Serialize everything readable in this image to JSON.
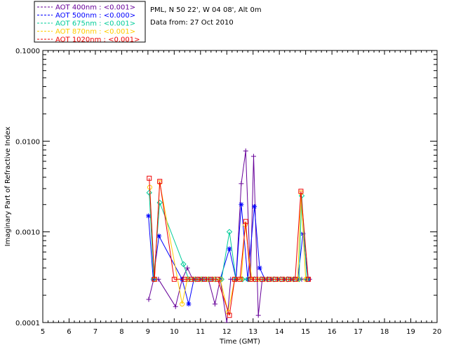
{
  "header": {
    "station": "PML, N 50 22', W 04 08', Alt 0m",
    "date": "Data from: 27 Oct 2010"
  },
  "chart_data": {
    "type": "line",
    "title": "",
    "xlabel": "Time (GMT)",
    "ylabel": "Imaginary Part of Refractive Index",
    "xlim": [
      5,
      20
    ],
    "ylim": [
      0.0001,
      0.1
    ],
    "yscale": "log",
    "x_ticks": [
      "5",
      "6",
      "7",
      "8",
      "9",
      "10",
      "11",
      "12",
      "13",
      "14",
      "15",
      "16",
      "17",
      "18",
      "19",
      "20"
    ],
    "y_ticks": [
      "0.0001",
      "0.0010",
      "0.0100",
      "0.1000"
    ],
    "legend_position": "top-left, outside",
    "series": [
      {
        "name": "AOT  400nm : <0.001>",
        "color": "#660099",
        "marker": "+",
        "points": [
          [
            9.03,
            0.00018
          ],
          [
            9.22,
            0.0003
          ],
          [
            9.4,
            0.0003
          ],
          [
            10.05,
            0.00015
          ],
          [
            10.3,
            0.0003
          ],
          [
            10.5,
            0.0004
          ],
          [
            10.7,
            0.0003
          ],
          [
            10.9,
            0.0003
          ],
          [
            11.1,
            0.0003
          ],
          [
            11.3,
            0.0003
          ],
          [
            11.55,
            0.00016
          ],
          [
            11.75,
            0.0003
          ],
          [
            12.0,
            0.0001
          ],
          [
            12.15,
            0.0003
          ],
          [
            12.35,
            0.0003
          ],
          [
            12.55,
            0.0034
          ],
          [
            12.72,
            0.0078
          ],
          [
            12.9,
            0.0003
          ],
          [
            13.02,
            0.0068
          ],
          [
            13.2,
            0.00012
          ],
          [
            13.35,
            0.0003
          ],
          [
            13.55,
            0.0003
          ],
          [
            13.75,
            0.0003
          ],
          [
            13.95,
            0.0003
          ],
          [
            14.15,
            0.0003
          ],
          [
            14.35,
            0.0003
          ],
          [
            14.55,
            0.0003
          ],
          [
            14.72,
            0.0003
          ],
          [
            14.85,
            0.0003
          ],
          [
            15.0,
            0.0003
          ],
          [
            15.15,
            0.0003
          ]
        ]
      },
      {
        "name": "AOT  500nm : <0.000>",
        "color": "#0000ff",
        "marker": "*",
        "points": [
          [
            9.02,
            0.0015
          ],
          [
            9.2,
            0.0003
          ],
          [
            9.42,
            0.0009
          ],
          [
            10.3,
            0.0003
          ],
          [
            10.55,
            0.00016
          ],
          [
            10.75,
            0.0003
          ],
          [
            11.0,
            0.0003
          ],
          [
            11.2,
            0.0003
          ],
          [
            11.45,
            0.0003
          ],
          [
            11.75,
            0.0003
          ],
          [
            12.1,
            0.00065
          ],
          [
            12.35,
            0.0003
          ],
          [
            12.55,
            0.002
          ],
          [
            12.8,
            0.0003
          ],
          [
            13.05,
            0.0019
          ],
          [
            13.25,
            0.0004
          ],
          [
            13.45,
            0.0003
          ],
          [
            13.7,
            0.0003
          ],
          [
            13.95,
            0.0003
          ],
          [
            14.2,
            0.0003
          ],
          [
            14.45,
            0.0003
          ],
          [
            14.7,
            0.0003
          ],
          [
            14.9,
            0.00095
          ],
          [
            15.1,
            0.0003
          ]
        ]
      },
      {
        "name": "AOT  675nm : <0.001>",
        "color": "#00cc99",
        "marker": "◇",
        "points": [
          [
            9.05,
            0.0027
          ],
          [
            9.22,
            0.0003
          ],
          [
            9.45,
            0.0021
          ],
          [
            10.35,
            0.00044
          ],
          [
            10.55,
            0.0003
          ],
          [
            10.8,
            0.0003
          ],
          [
            11.05,
            0.0003
          ],
          [
            11.3,
            0.0003
          ],
          [
            11.55,
            0.0003
          ],
          [
            11.8,
            0.0003
          ],
          [
            12.1,
            0.001
          ],
          [
            12.35,
            0.0003
          ],
          [
            12.6,
            0.0003
          ],
          [
            12.8,
            0.0003
          ],
          [
            13.05,
            0.0003
          ],
          [
            13.3,
            0.0003
          ],
          [
            13.55,
            0.0003
          ],
          [
            13.8,
            0.0003
          ],
          [
            14.05,
            0.0003
          ],
          [
            14.3,
            0.0003
          ],
          [
            14.55,
            0.0003
          ],
          [
            14.75,
            0.0003
          ],
          [
            14.85,
            0.0025
          ],
          [
            15.05,
            0.0003
          ]
        ]
      },
      {
        "name": "AOT  870nm : <0.001>",
        "color": "#ffcc00",
        "marker": "○",
        "points": [
          [
            9.07,
            0.0031
          ],
          [
            9.25,
            0.0003
          ],
          [
            9.45,
            0.0035
          ],
          [
            10.3,
            0.00016
          ],
          [
            10.5,
            0.0003
          ],
          [
            10.75,
            0.0003
          ],
          [
            11.0,
            0.0003
          ],
          [
            11.25,
            0.0003
          ],
          [
            11.5,
            0.0003
          ],
          [
            11.75,
            0.0003
          ],
          [
            12.05,
            0.00013
          ],
          [
            12.3,
            0.0003
          ],
          [
            12.55,
            0.0003
          ],
          [
            12.7,
            0.0012
          ],
          [
            12.95,
            0.0003
          ],
          [
            13.2,
            0.0003
          ],
          [
            13.45,
            0.0003
          ],
          [
            13.7,
            0.0003
          ],
          [
            13.95,
            0.0003
          ],
          [
            14.2,
            0.0003
          ],
          [
            14.45,
            0.0003
          ],
          [
            14.7,
            0.0003
          ],
          [
            14.82,
            0.0027
          ],
          [
            15.0,
            0.0003
          ]
        ]
      },
      {
        "name": "AOT 1020nm : <0.001>",
        "color": "#ee0000",
        "marker": "□",
        "points": [
          [
            9.05,
            0.0039
          ],
          [
            9.25,
            0.0003
          ],
          [
            9.45,
            0.0036
          ],
          [
            10.0,
            0.0003
          ],
          [
            10.4,
            0.0003
          ],
          [
            10.65,
            0.0003
          ],
          [
            10.9,
            0.0003
          ],
          [
            11.15,
            0.0003
          ],
          [
            11.4,
            0.0003
          ],
          [
            11.65,
            0.0003
          ],
          [
            12.1,
            0.00012
          ],
          [
            12.3,
            0.0003
          ],
          [
            12.5,
            0.0003
          ],
          [
            12.72,
            0.0013
          ],
          [
            12.9,
            0.0003
          ],
          [
            13.1,
            0.0003
          ],
          [
            13.35,
            0.0003
          ],
          [
            13.6,
            0.0003
          ],
          [
            13.85,
            0.0003
          ],
          [
            14.1,
            0.0003
          ],
          [
            14.35,
            0.0003
          ],
          [
            14.6,
            0.0003
          ],
          [
            14.82,
            0.0028
          ],
          [
            15.1,
            0.0003
          ]
        ]
      }
    ]
  }
}
